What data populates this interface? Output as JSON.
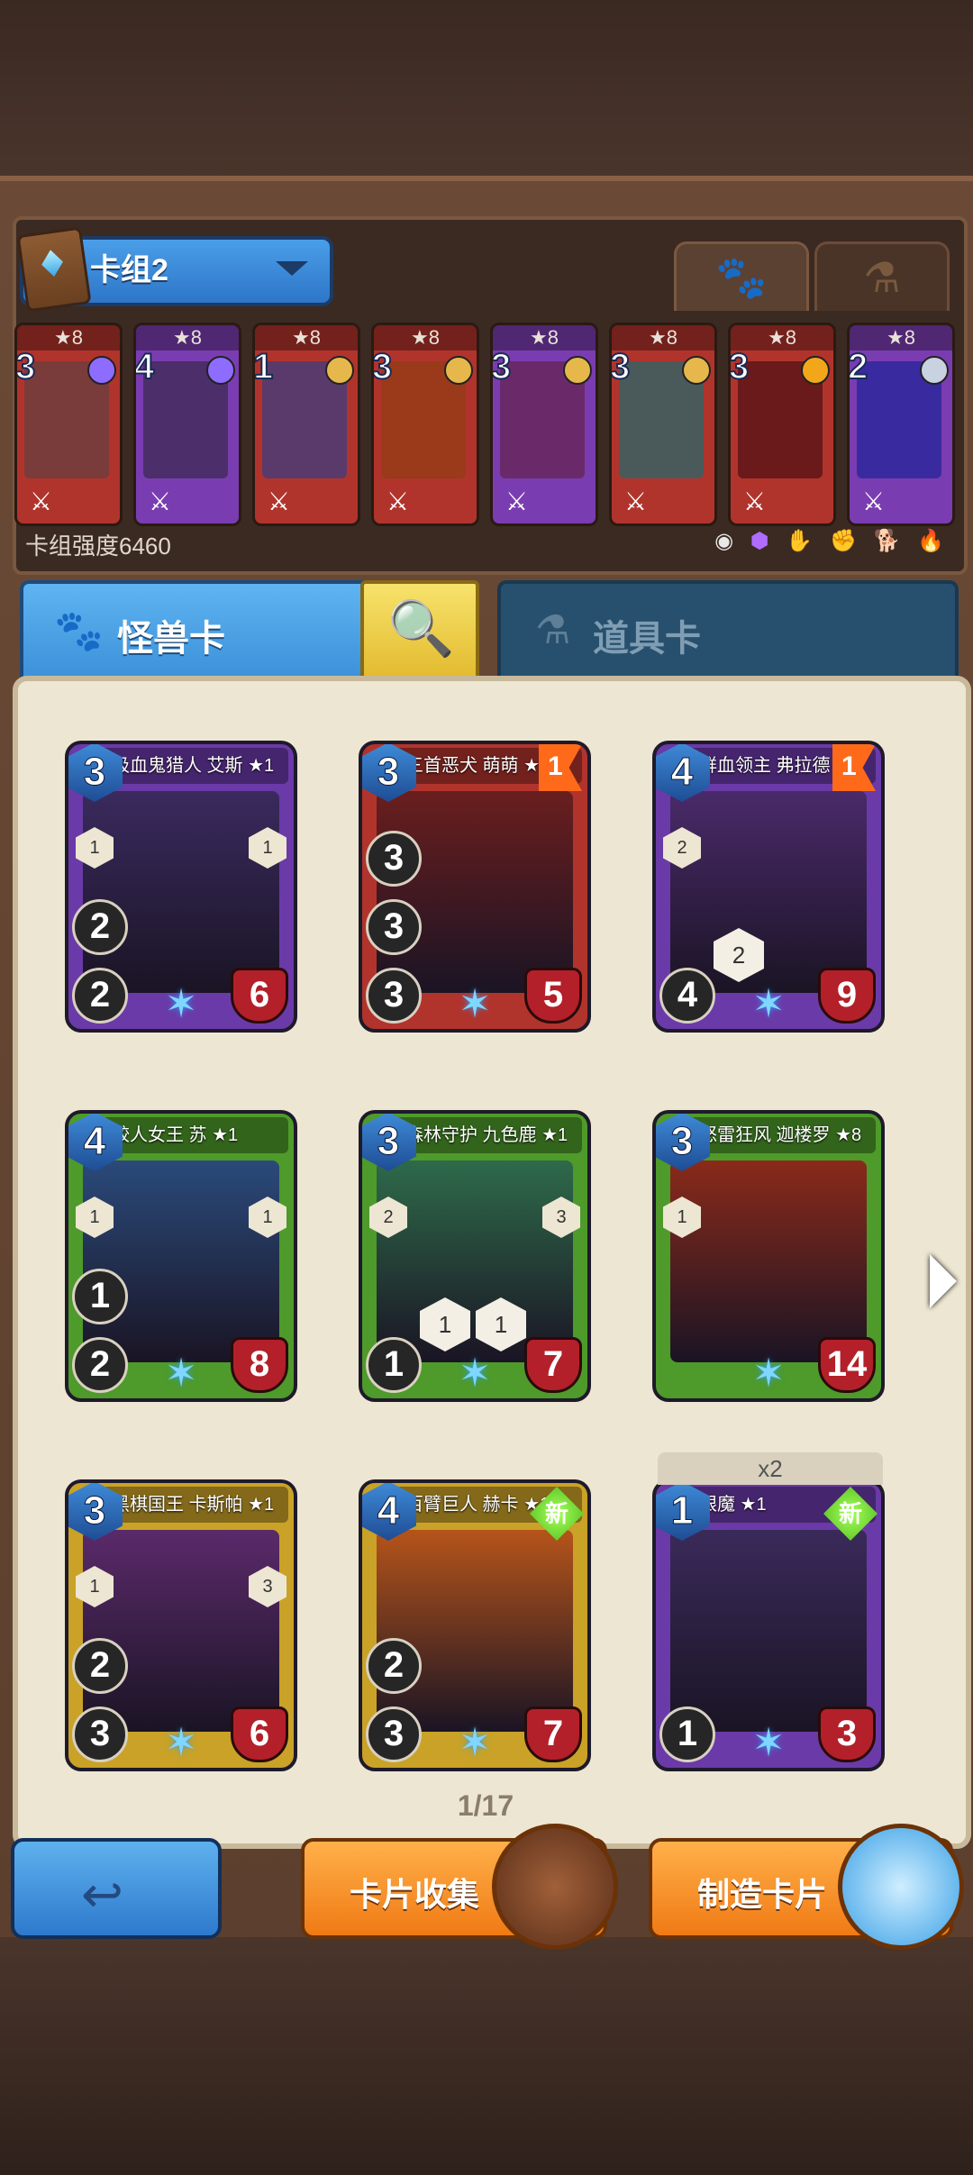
{
  "deck": {
    "name": "卡组2",
    "power_label": "卡组强度6460",
    "tabs": {
      "monster_icon": "paw-icon",
      "item_icon": "potion-icon"
    },
    "cards": [
      {
        "stars": "★8",
        "cost": "3",
        "color": "#b1342c",
        "art": "#7a3b3b",
        "gem": "#8e6cff"
      },
      {
        "stars": "★8",
        "cost": "4",
        "color": "#7a3db1",
        "art": "#4b2e6a",
        "gem": "#8e6cff"
      },
      {
        "stars": "★8",
        "cost": "1",
        "color": "#b1342c",
        "art": "#5a3a6a",
        "gem": "#e6b84b"
      },
      {
        "stars": "★8",
        "cost": "3",
        "color": "#b1342c",
        "art": "#9a3a1a",
        "gem": "#e6b84b"
      },
      {
        "stars": "★8",
        "cost": "3",
        "color": "#7a3db1",
        "art": "#6a2a6a",
        "gem": "#e6b84b"
      },
      {
        "stars": "★8",
        "cost": "3",
        "color": "#b1342c",
        "art": "#4a5a5a",
        "gem": "#e6b84b"
      },
      {
        "stars": "★8",
        "cost": "3",
        "color": "#b1342c",
        "art": "#6a1a1a",
        "gem": "#f2a61a"
      },
      {
        "stars": "★8",
        "cost": "2",
        "color": "#7a3db1",
        "art": "#3a2aa0",
        "gem": "#c8d2e0"
      }
    ]
  },
  "categories": {
    "monster": "怪兽卡",
    "item": "道具卡",
    "search_icon": "magnifier-icon"
  },
  "collection": {
    "duplicate_tag": "x2",
    "page": "1/17",
    "cards": [
      {
        "name": "吸血鬼猎人 艾斯 ★1",
        "cost": "3",
        "atk": "2",
        "atk2": "2",
        "hp": "6",
        "frame": "#6a3aa8",
        "art": "#3a2a5e",
        "flag": "",
        "new": "",
        "hex_left": "1",
        "hex_right": "1"
      },
      {
        "name": "三首恶犬 萌萌 ★8",
        "cost": "3",
        "atk": "3",
        "atk2": "3",
        "hp": "5",
        "frame": "#b1342c",
        "art": "#6a1e1e",
        "flag": "1",
        "new": "",
        "hex_left": "",
        "hex_right": "",
        "atk3": "3"
      },
      {
        "name": "鲜血领主 弗拉德 ★8",
        "cost": "4",
        "atk": "4",
        "atk2": "",
        "hp": "9",
        "frame": "#6a3aa8",
        "art": "#4a2a6a",
        "flag": "1",
        "new": "",
        "hex_left": "2",
        "hex_right": "",
        "ability1": "2"
      },
      {
        "name": "鲛人女王 苏 ★1",
        "cost": "4",
        "atk": "1",
        "atk2": "2",
        "hp": "8",
        "frame": "#4e9a2a",
        "art": "#2a4a7a",
        "flag": "",
        "new": "",
        "hex_left": "1",
        "hex_right": "1"
      },
      {
        "name": "森林守护 九色鹿 ★1",
        "cost": "3",
        "atk": "1",
        "atk2": "",
        "hp": "7",
        "frame": "#4e9a2a",
        "art": "#2e6a4a",
        "flag": "",
        "new": "",
        "hex_left": "2",
        "hex_right": "3",
        "ability1": "1",
        "ability2": "1"
      },
      {
        "name": "怒雷狂风 迦楼罗 ★8",
        "cost": "3",
        "atk": "",
        "atk2": "",
        "hp": "14",
        "frame": "#4e9a2a",
        "art": "#8a2a1a",
        "flag": "",
        "new": "",
        "hex_left": "1",
        "hex_right": ""
      },
      {
        "name": "黑棋国王 卡斯帕 ★1",
        "cost": "3",
        "atk": "2",
        "atk2": "3",
        "hp": "6",
        "frame": "#c9a227",
        "art": "#5a2a6a",
        "flag": "",
        "new": "",
        "hex_left": "1",
        "hex_right": "3"
      },
      {
        "name": "百臂巨人 赫卡 ★1",
        "cost": "4",
        "atk": "2",
        "atk2": "3",
        "hp": "7",
        "frame": "#c9a227",
        "art": "#b5541a",
        "flag": "",
        "new": "新",
        "hex_left": "",
        "hex_right": ""
      },
      {
        "name": "眼魔 ★1",
        "cost": "1",
        "atk": "1",
        "atk2": "",
        "hp": "3",
        "frame": "#6a3aa8",
        "art": "#3a2a5a",
        "flag": "",
        "new": "新",
        "hex_left": "",
        "hex_right": ""
      }
    ]
  },
  "buttons": {
    "back_icon": "back-arrow-icon",
    "collect": "卡片收集",
    "craft": "制造卡片"
  }
}
